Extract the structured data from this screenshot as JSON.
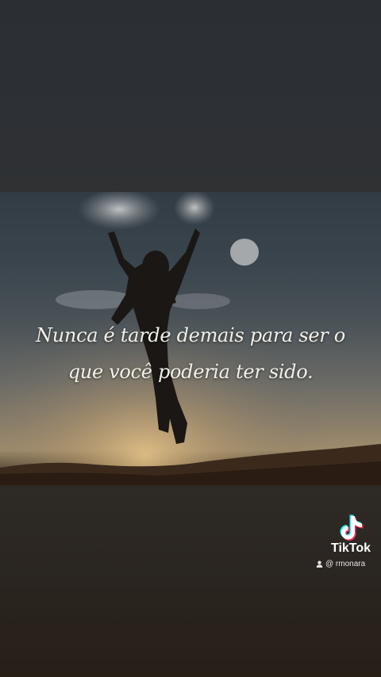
{
  "quote": {
    "line1": "Nunca é tarde demais para ser o",
    "line2": "que você poderia ter sido."
  },
  "watermark": {
    "brand": "TikTok",
    "handle": "@ rmonara",
    "icon": "tiktok-logo-icon",
    "user_icon": "user-icon"
  },
  "colors": {
    "quote_text": "#f2f0ea",
    "brand_cyan": "#25f4ee",
    "brand_red": "#fe2c55"
  }
}
